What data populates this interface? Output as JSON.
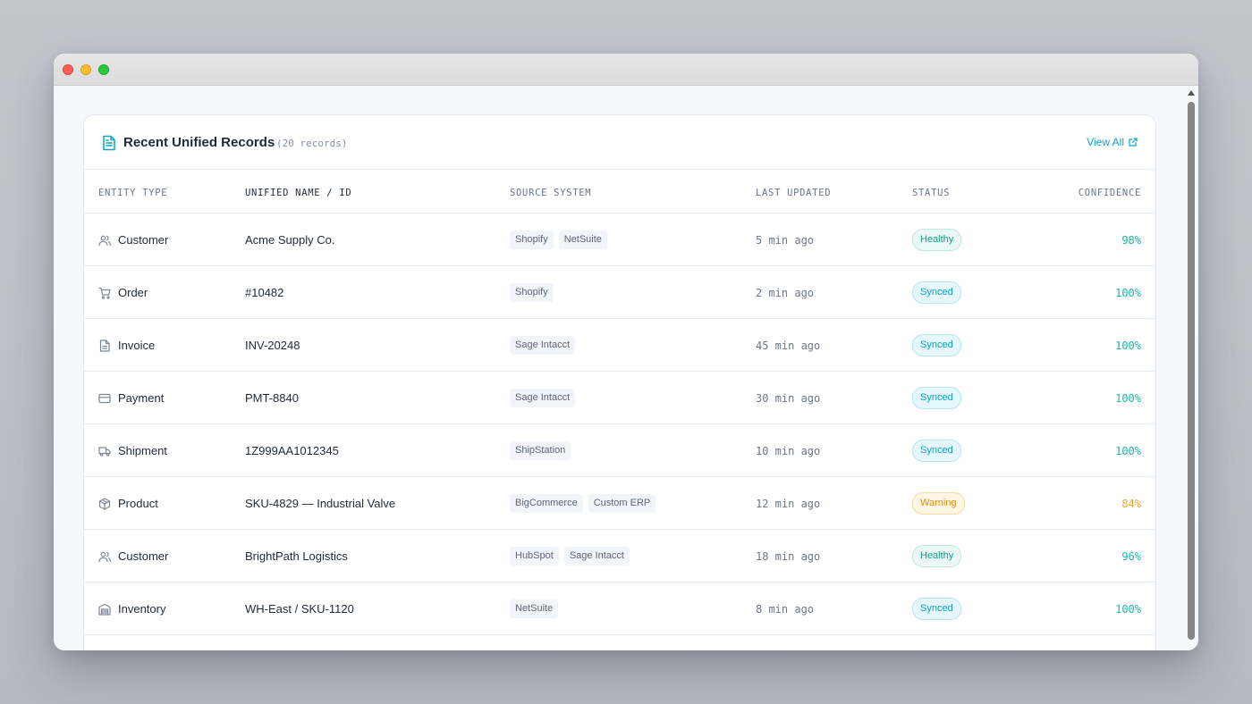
{
  "panel": {
    "title": "Recent Unified Records",
    "record_count": "(20 records)",
    "view_all": "View All"
  },
  "columns": {
    "entity_type": "Entity Type",
    "name": "Unified Name / ID",
    "source": "Source System",
    "updated": "Last Updated",
    "status": "Status",
    "confidence": "Confidence"
  },
  "colors": {
    "accent": "#0ea5c6",
    "healthy": "#0f9f8a",
    "synced": "#0e9ebd",
    "warning": "#d9900b"
  },
  "rows": [
    {
      "type": "Customer",
      "icon": "users-icon",
      "name": "Acme Supply Co.",
      "sources": [
        "Shopify",
        "NetSuite"
      ],
      "updated": "5 min ago",
      "status": "Healthy",
      "status_kind": "healthy",
      "confidence": "98%",
      "conf_kind": "teal"
    },
    {
      "type": "Order",
      "icon": "cart-icon",
      "name": "#10482",
      "sources": [
        "Shopify"
      ],
      "updated": "2 min ago",
      "status": "Synced",
      "status_kind": "synced",
      "confidence": "100%",
      "conf_kind": "teal"
    },
    {
      "type": "Invoice",
      "icon": "document-icon",
      "name": "INV-20248",
      "sources": [
        "Sage Intacct"
      ],
      "updated": "45 min ago",
      "status": "Synced",
      "status_kind": "synced",
      "confidence": "100%",
      "conf_kind": "teal"
    },
    {
      "type": "Payment",
      "icon": "credit-card-icon",
      "name": "PMT-8840",
      "sources": [
        "Sage Intacct"
      ],
      "updated": "30 min ago",
      "status": "Synced",
      "status_kind": "synced",
      "confidence": "100%",
      "conf_kind": "teal"
    },
    {
      "type": "Shipment",
      "icon": "truck-icon",
      "name": "1Z999AA1012345",
      "sources": [
        "ShipStation"
      ],
      "updated": "10 min ago",
      "status": "Synced",
      "status_kind": "synced",
      "confidence": "100%",
      "conf_kind": "teal"
    },
    {
      "type": "Product",
      "icon": "package-icon",
      "name": "SKU-4829 — Industrial Valve",
      "sources": [
        "BigCommerce",
        "Custom ERP"
      ],
      "updated": "12 min ago",
      "status": "Warning",
      "status_kind": "warning",
      "confidence": "84%",
      "conf_kind": "amber"
    },
    {
      "type": "Customer",
      "icon": "users-icon",
      "name": "BrightPath Logistics",
      "sources": [
        "HubSpot",
        "Sage Intacct"
      ],
      "updated": "18 min ago",
      "status": "Healthy",
      "status_kind": "healthy",
      "confidence": "96%",
      "conf_kind": "teal"
    },
    {
      "type": "Inventory",
      "icon": "warehouse-icon",
      "name": "WH-East / SKU-1120",
      "sources": [
        "NetSuite"
      ],
      "updated": "8 min ago",
      "status": "Synced",
      "status_kind": "synced",
      "confidence": "100%",
      "conf_kind": "teal"
    }
  ]
}
